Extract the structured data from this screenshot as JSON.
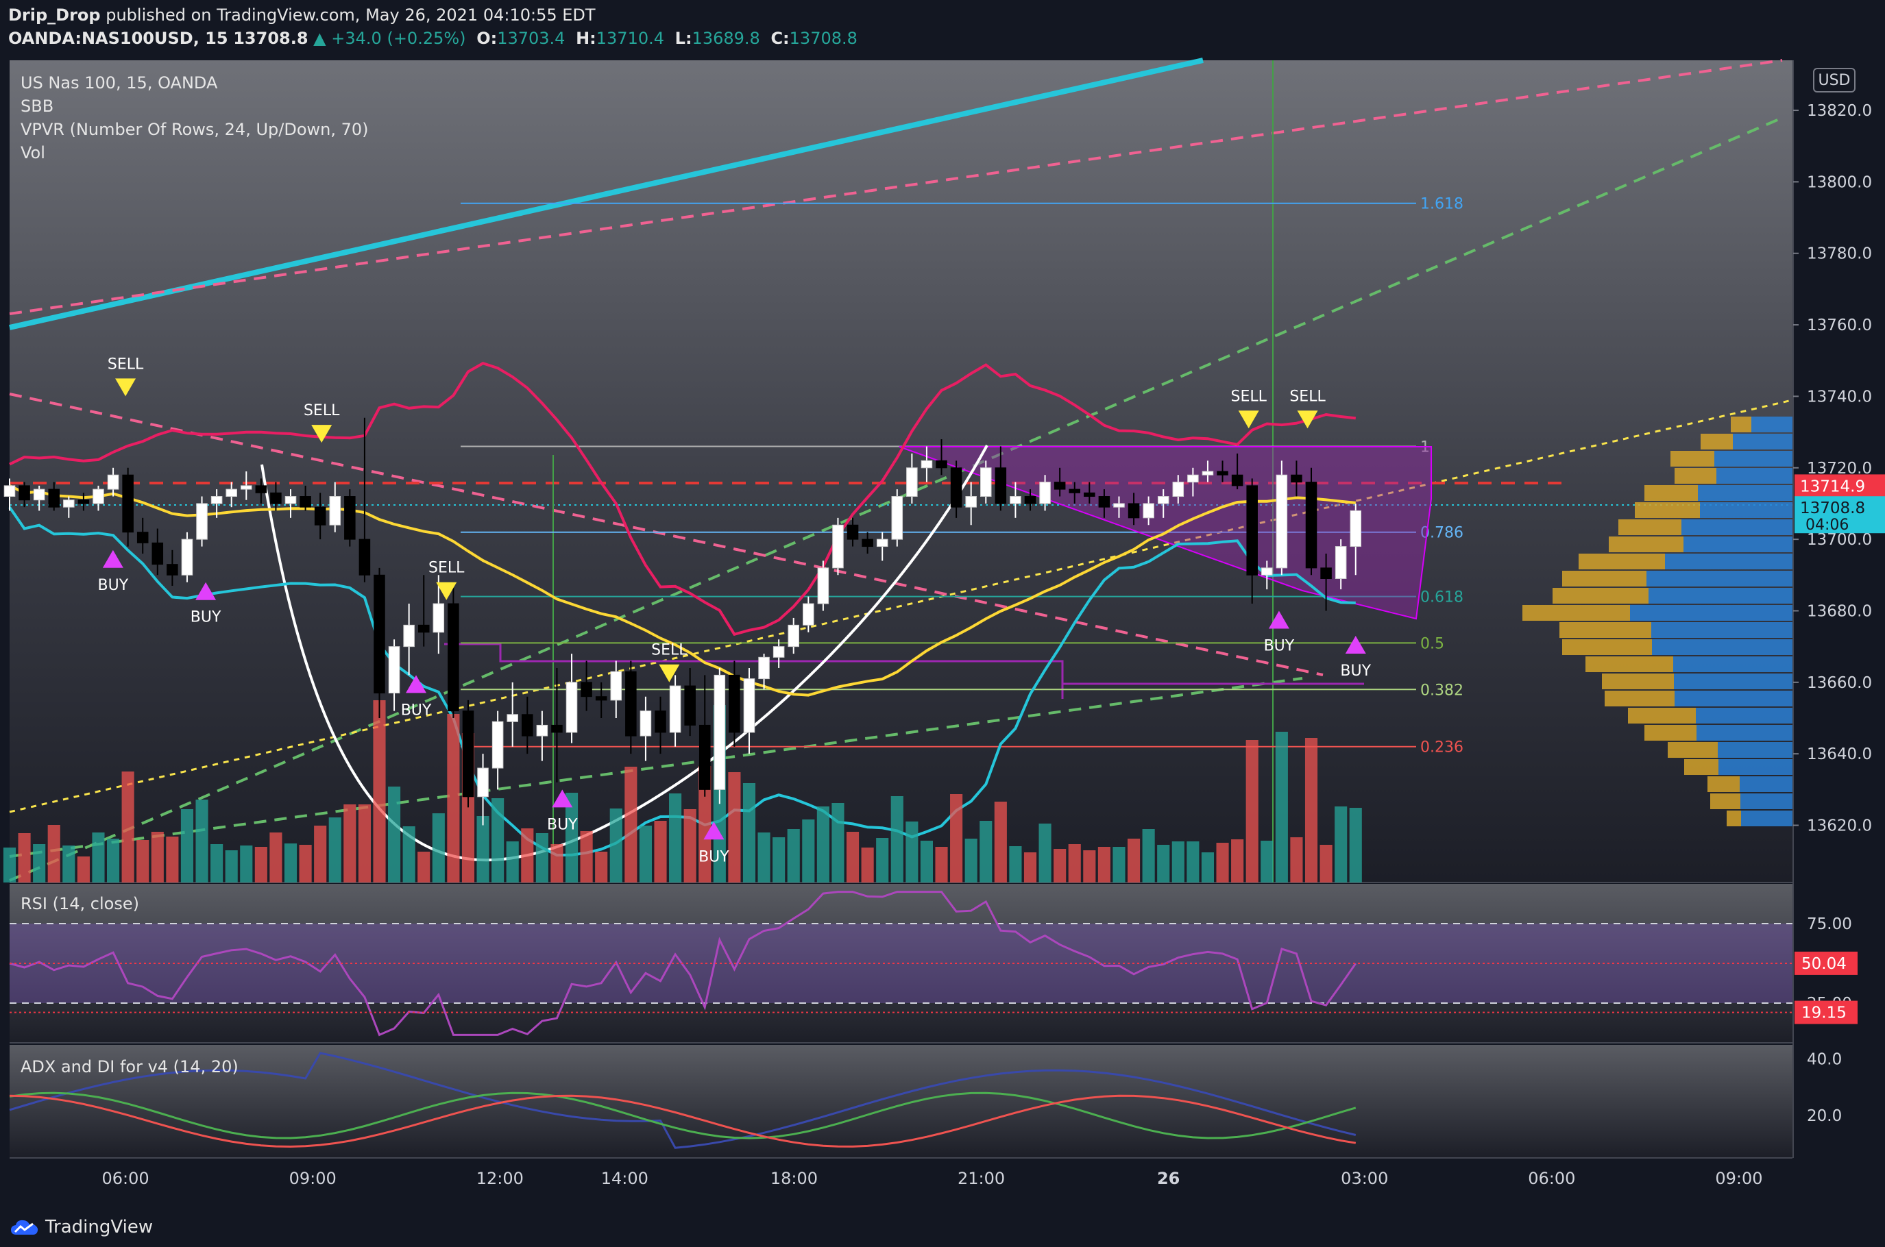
{
  "header": {
    "author": "Drip_Drop",
    "published": "published on TradingView.com, May 26, 2021 04:10:55 EDT",
    "symbol": "OANDA:NAS100USD, 15",
    "last": "13708.8",
    "change": "+34.0 (+0.25%)",
    "o_label": "O:",
    "o_value": "13703.4",
    "h_label": "H:",
    "h_value": "13710.4",
    "l_label": "L:",
    "l_value": "13689.8",
    "c_label": "C:",
    "c_value": "13708.8"
  },
  "main_legend": {
    "title": "US Nas 100, 15, OANDA",
    "line2": "SBB",
    "line3": "VPVR (Number Of Rows, 24, Up/Down, 70)",
    "line4": "Vol"
  },
  "rsi_legend": "RSI (14, close)",
  "adx_legend": "ADX and DI for v4 (14, 20)",
  "currency": "USD",
  "footer": {
    "brand": "TradingView"
  },
  "colors": {
    "up_candle": "#ffffff",
    "down_candle": "#000000",
    "vol_up": "#26a69a",
    "vol_down": "#ef5350",
    "bb_upper": "#e91e63",
    "bb_lower": "#26c6da",
    "basis": "#fdd835",
    "signal_sell": "#ffeb3b",
    "signal_buy": "#e040fb",
    "price_red": "#f23645",
    "price_teal": "#26c6da"
  },
  "chart_data": [
    {
      "type": "candlestick",
      "title": "US Nas 100, 15, OANDA",
      "y_ticks": [
        "13820.0",
        "13800.0",
        "13780.0",
        "13760.0",
        "13740.0",
        "13720.0",
        "13700.0",
        "13680.0",
        "13660.0",
        "13640.0",
        "13620.0"
      ],
      "ylim": [
        13604,
        13834
      ],
      "x_ticks": [
        {
          "label": "06:00",
          "x": 0.065
        },
        {
          "label": "09:00",
          "x": 0.17
        },
        {
          "label": "12:00",
          "x": 0.275
        },
        {
          "label": "14:00",
          "x": 0.345
        },
        {
          "label": "18:00",
          "x": 0.44
        },
        {
          "label": "21:00",
          "x": 0.545
        },
        {
          "label": "26",
          "x": 0.65
        },
        {
          "label": "03:00",
          "x": 0.76
        },
        {
          "label": "06:00",
          "x": 0.865
        },
        {
          "label": "09:00",
          "x": 0.97
        }
      ],
      "price_labels": [
        {
          "value": "13714.9",
          "kind": "red"
        },
        {
          "value": "13708.8",
          "kind": "teal",
          "sub": "04:06"
        }
      ],
      "fib_levels": [
        {
          "label": "1.618",
          "value": 13794
        },
        {
          "label": "1",
          "value": 13726
        },
        {
          "label": "0.786",
          "value": 13702
        },
        {
          "label": "0.618",
          "value": 13684
        },
        {
          "label": "0.5",
          "value": 13671
        },
        {
          "label": "0.382",
          "value": 13658
        },
        {
          "label": "0.236",
          "value": 13642
        }
      ],
      "signals": [
        {
          "label": "SELL",
          "kind": "sell",
          "x": 0.065,
          "price": 13745
        },
        {
          "label": "BUY",
          "kind": "buy",
          "x": 0.058,
          "price": 13697
        },
        {
          "label": "BUY",
          "kind": "buy",
          "x": 0.11,
          "price": 13688
        },
        {
          "label": "SELL",
          "kind": "sell",
          "x": 0.175,
          "price": 13732
        },
        {
          "label": "SELL",
          "kind": "sell",
          "x": 0.245,
          "price": 13688
        },
        {
          "label": "BUY",
          "kind": "buy",
          "x": 0.228,
          "price": 13662
        },
        {
          "label": "BUY",
          "kind": "buy",
          "x": 0.31,
          "price": 13630
        },
        {
          "label": "SELL",
          "kind": "sell",
          "x": 0.37,
          "price": 13665
        },
        {
          "label": "BUY",
          "kind": "buy",
          "x": 0.395,
          "price": 13621
        },
        {
          "label": "SELL",
          "kind": "sell",
          "x": 0.695,
          "price": 13736
        },
        {
          "label": "SELL",
          "kind": "sell",
          "x": 0.728,
          "price": 13736
        },
        {
          "label": "BUY",
          "kind": "buy",
          "x": 0.712,
          "price": 13680
        },
        {
          "label": "BUY",
          "kind": "buy",
          "x": 0.755,
          "price": 13673
        }
      ],
      "candles": [
        [
          13712,
          13717,
          13708,
          13715
        ],
        [
          13715,
          13716,
          13709,
          13711
        ],
        [
          13711,
          13715,
          13708,
          13714
        ],
        [
          13714,
          13716,
          13708,
          13709
        ],
        [
          13709,
          13712,
          13706,
          13711
        ],
        [
          13711,
          13713,
          13708,
          13710
        ],
        [
          13710,
          13715,
          13708,
          13714
        ],
        [
          13714,
          13720,
          13712,
          13718
        ],
        [
          13718,
          13720,
          13698,
          13702
        ],
        [
          13702,
          13706,
          13696,
          13699
        ],
        [
          13699,
          13703,
          13690,
          13693
        ],
        [
          13693,
          13697,
          13687,
          13690
        ],
        [
          13690,
          13702,
          13688,
          13700
        ],
        [
          13700,
          13712,
          13698,
          13710
        ],
        [
          13710,
          13714,
          13706,
          13712
        ],
        [
          13712,
          13716,
          13709,
          13714
        ],
        [
          13714,
          13719,
          13711,
          13715
        ],
        [
          13715,
          13717,
          13710,
          13713
        ],
        [
          13713,
          13716,
          13708,
          13710
        ],
        [
          13710,
          13714,
          13706,
          13712
        ],
        [
          13712,
          13715,
          13708,
          13709
        ],
        [
          13709,
          13713,
          13700,
          13704
        ],
        [
          13704,
          13716,
          13702,
          13712
        ],
        [
          13712,
          13714,
          13698,
          13700
        ],
        [
          13700,
          13734,
          13688,
          13690
        ],
        [
          13690,
          13692,
          13650,
          13657
        ],
        [
          13657,
          13672,
          13652,
          13670
        ],
        [
          13670,
          13682,
          13662,
          13676
        ],
        [
          13676,
          13690,
          13670,
          13674
        ],
        [
          13674,
          13690,
          13668,
          13682
        ],
        [
          13682,
          13688,
          13650,
          13652
        ],
        [
          13652,
          13655,
          13625,
          13628
        ],
        [
          13628,
          13640,
          13620,
          13636
        ],
        [
          13636,
          13652,
          13630,
          13649
        ],
        [
          13649,
          13660,
          13642,
          13651
        ],
        [
          13651,
          13656,
          13640,
          13645
        ],
        [
          13645,
          13652,
          13638,
          13648
        ],
        [
          13648,
          13664,
          13632,
          13646
        ],
        [
          13646,
          13668,
          13643,
          13660
        ],
        [
          13660,
          13666,
          13652,
          13656
        ],
        [
          13656,
          13660,
          13650,
          13655
        ],
        [
          13655,
          13666,
          13650,
          13663
        ],
        [
          13663,
          13666,
          13640,
          13645
        ],
        [
          13645,
          13656,
          13638,
          13652
        ],
        [
          13652,
          13656,
          13640,
          13646
        ],
        [
          13646,
          13662,
          13642,
          13659
        ],
        [
          13659,
          13664,
          13645,
          13648
        ],
        [
          13648,
          13662,
          13628,
          13630
        ],
        [
          13630,
          13664,
          13626,
          13662
        ],
        [
          13662,
          13666,
          13642,
          13646
        ],
        [
          13646,
          13664,
          13640,
          13661
        ],
        [
          13661,
          13668,
          13658,
          13667
        ],
        [
          13667,
          13672,
          13664,
          13670
        ],
        [
          13670,
          13678,
          13668,
          13676
        ],
        [
          13676,
          13684,
          13674,
          13682
        ],
        [
          13682,
          13694,
          13680,
          13692
        ],
        [
          13692,
          13706,
          13690,
          13704
        ],
        [
          13704,
          13706,
          13698,
          13700
        ],
        [
          13700,
          13702,
          13696,
          13698
        ],
        [
          13698,
          13702,
          13694,
          13700
        ],
        [
          13700,
          13714,
          13698,
          13712
        ],
        [
          13712,
          13724,
          13710,
          13720
        ],
        [
          13720,
          13726,
          13716,
          13722
        ],
        [
          13722,
          13728,
          13718,
          13720
        ],
        [
          13720,
          13722,
          13706,
          13709
        ],
        [
          13709,
          13716,
          13704,
          13712
        ],
        [
          13712,
          13722,
          13710,
          13720
        ],
        [
          13720,
          13726,
          13708,
          13710
        ],
        [
          13710,
          13716,
          13706,
          13712
        ],
        [
          13712,
          13714,
          13708,
          13710
        ],
        [
          13710,
          13718,
          13708,
          13716
        ],
        [
          13716,
          13720,
          13712,
          13714
        ],
        [
          13714,
          13716,
          13710,
          13713
        ],
        [
          13713,
          13716,
          13710,
          13712
        ],
        [
          13712,
          13714,
          13706,
          13709
        ],
        [
          13709,
          13712,
          13706,
          13710
        ],
        [
          13710,
          13713,
          13704,
          13706
        ],
        [
          13706,
          13712,
          13704,
          13710
        ],
        [
          13710,
          13714,
          13706,
          13712
        ],
        [
          13712,
          13718,
          13710,
          13716
        ],
        [
          13716,
          13720,
          13712,
          13718
        ],
        [
          13718,
          13722,
          13716,
          13719
        ],
        [
          13719,
          13722,
          13716,
          13718
        ],
        [
          13718,
          13724,
          13714,
          13715
        ],
        [
          13715,
          13717,
          13682,
          13690
        ],
        [
          13690,
          13694,
          13686,
          13692
        ],
        [
          13692,
          13722,
          13690,
          13718
        ],
        [
          13718,
          13722,
          13712,
          13716
        ],
        [
          13716,
          13720,
          13690,
          13692
        ],
        [
          13692,
          13696,
          13680,
          13689
        ],
        [
          13689,
          13700,
          13686,
          13698
        ],
        [
          13698,
          13710,
          13690,
          13708
        ]
      ]
    },
    {
      "type": "line",
      "title": "RSI (14, close)",
      "y_ticks": [
        "75.00",
        "25.00"
      ],
      "ylim": [
        0,
        100
      ],
      "price_labels": [
        {
          "value": "50.04",
          "kind": "red"
        },
        {
          "value": "19.15",
          "kind": "red"
        }
      ]
    },
    {
      "type": "line",
      "title": "ADX and DI for v4 (14, 20)",
      "y_ticks": [
        "40.0",
        "20.0"
      ],
      "ylim": [
        5,
        45
      ]
    }
  ]
}
